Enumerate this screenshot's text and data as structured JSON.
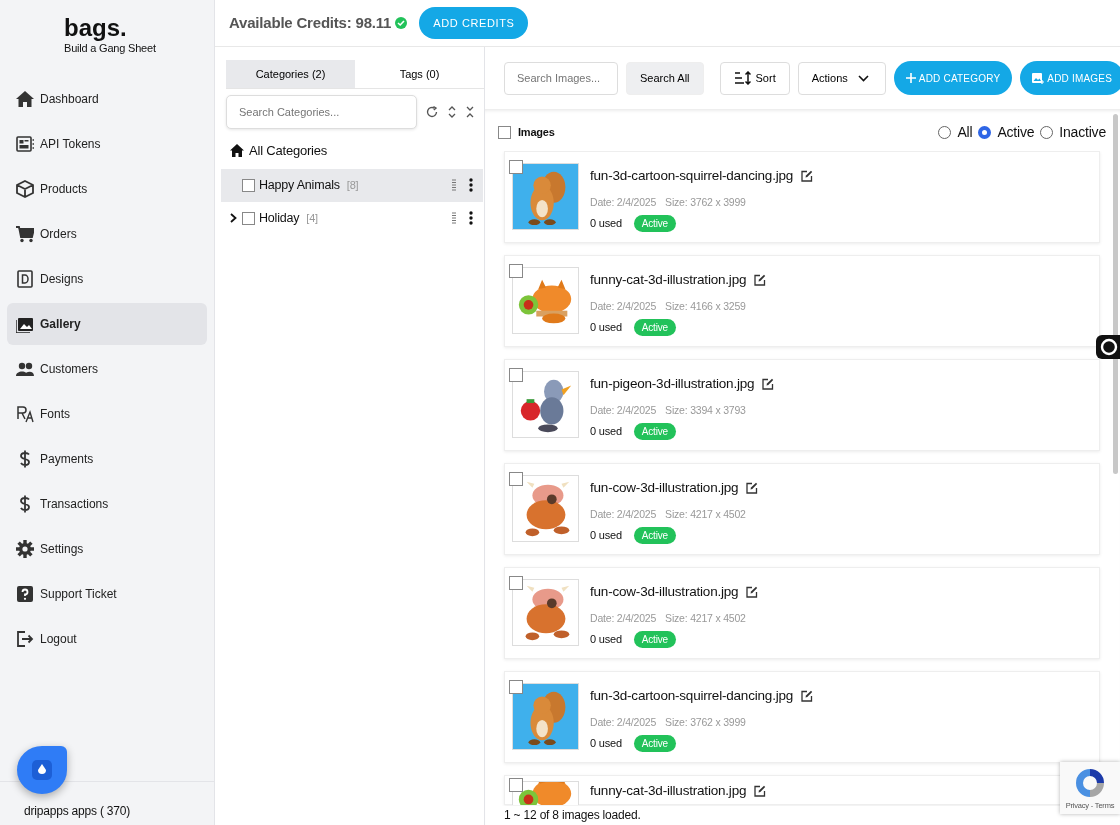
{
  "brand": {
    "name": "bags.",
    "tagline": "Build a Gang Sheet"
  },
  "sidebar": {
    "items": [
      {
        "label": "Dashboard",
        "selected": false
      },
      {
        "label": "API Tokens",
        "selected": false
      },
      {
        "label": "Products",
        "selected": false
      },
      {
        "label": "Orders",
        "selected": false
      },
      {
        "label": "Designs",
        "selected": false
      },
      {
        "label": "Gallery",
        "selected": true
      },
      {
        "label": "Customers",
        "selected": false
      },
      {
        "label": "Fonts",
        "selected": false
      },
      {
        "label": "Payments",
        "selected": false
      },
      {
        "label": "Transactions",
        "selected": false
      },
      {
        "label": "Settings",
        "selected": false
      },
      {
        "label": "Support Ticket",
        "selected": false
      },
      {
        "label": "Logout",
        "selected": false
      }
    ],
    "footer": "dripapps apps ( 370)"
  },
  "header": {
    "credits": "Available Credits: 98.11",
    "button": "ADD CREDITS"
  },
  "categories_panel": {
    "tabs": [
      {
        "label": "Categories (2)",
        "selected": true
      },
      {
        "label": "Tags (0)",
        "selected": false
      }
    ],
    "search": {
      "placeholder": "Search Categories..."
    },
    "all_label": "All Categories",
    "items": [
      {
        "name": "Happy Animals",
        "count": "[8]",
        "checked": false,
        "selected": true,
        "has_children": false
      },
      {
        "name": "Holiday",
        "count": "[4]",
        "checked": false,
        "selected": false,
        "has_children": true
      }
    ]
  },
  "toolbar": {
    "search": {
      "placeholder": "Search Images..."
    },
    "search_button": "Search All",
    "sort": "Sort",
    "actions": "Actions",
    "add_category": "ADD CATEGORY",
    "add_images": "ADD IMAGES"
  },
  "images": {
    "select_all_label": "Images",
    "select_all_checked": false,
    "filter": [
      {
        "label": "All",
        "selected": false
      },
      {
        "label": "Active",
        "selected": true
      },
      {
        "label": "Inactive",
        "selected": false
      }
    ],
    "cards": [
      {
        "name": "fun-3d-cartoon-squirrel-dancing.jpg",
        "date": "Date: 2/4/2025",
        "size": "Size: 3762 x 3999",
        "used": "0 used",
        "status": "Active",
        "checked": false
      },
      {
        "name": "funny-cat-3d-illustration.jpg",
        "date": "Date: 2/4/2025",
        "size": "Size: 4166 x 3259",
        "used": "0 used",
        "status": "Active",
        "checked": false
      },
      {
        "name": "fun-pigeon-3d-illustration.jpg",
        "date": "Date: 2/4/2025",
        "size": "Size: 3394 x 3793",
        "used": "0 used",
        "status": "Active",
        "checked": false
      },
      {
        "name": "fun-cow-3d-illustration.jpg",
        "date": "Date: 2/4/2025",
        "size": "Size: 4217 x 4502",
        "used": "0 used",
        "status": "Active",
        "checked": false
      },
      {
        "name": "fun-cow-3d-illustration.jpg",
        "date": "Date: 2/4/2025",
        "size": "Size: 4217 x 4502",
        "used": "0 used",
        "status": "Active",
        "checked": false
      },
      {
        "name": "fun-3d-cartoon-squirrel-dancing.jpg",
        "date": "Date: 2/4/2025",
        "size": "Size: 3762 x 3999",
        "used": "0 used",
        "status": "Active",
        "checked": false
      },
      {
        "name": "funny-cat-3d-illustration.jpg",
        "checked": false
      }
    ],
    "status": "1 ~ 12 of 8 images loaded."
  },
  "recaptcha": {
    "links": "Privacy - Terms"
  }
}
